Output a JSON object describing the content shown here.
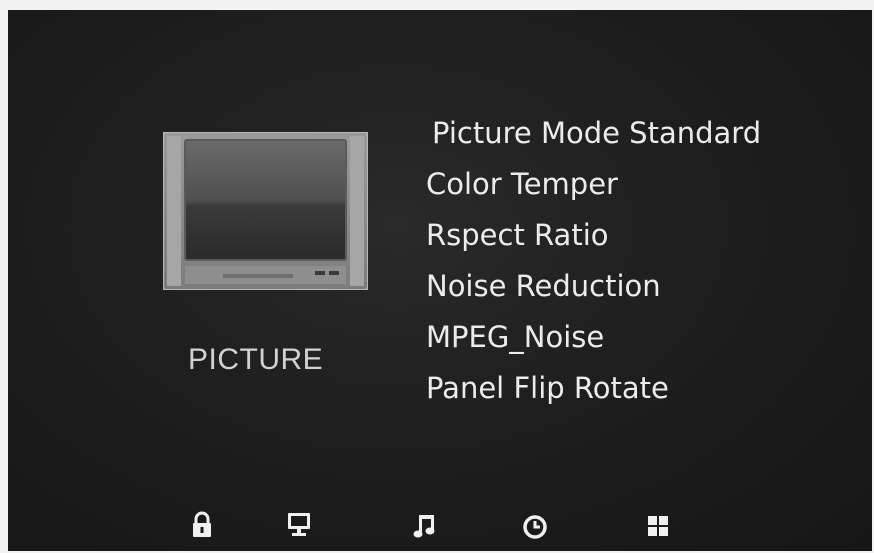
{
  "category": {
    "label": "PICTURE",
    "icon": "tv-icon"
  },
  "menu": {
    "items": [
      {
        "label": "Picture Mode Standard"
      },
      {
        "label": "Color Temper"
      },
      {
        "label": "Rspect Ratio"
      },
      {
        "label": "Noise Reduction"
      },
      {
        "label": "MPEG_Noise"
      },
      {
        "label": "Panel Flip Rotate"
      }
    ]
  },
  "bottom_nav": {
    "items": [
      {
        "icon": "lock-icon"
      },
      {
        "icon": "monitor-icon"
      },
      {
        "icon": "music-note-icon"
      },
      {
        "icon": "clock-icon"
      },
      {
        "icon": "grid-icon"
      }
    ]
  },
  "colors": {
    "background": "#1e1e1e",
    "text": "#ececec",
    "icon": "#f0f0f0"
  }
}
